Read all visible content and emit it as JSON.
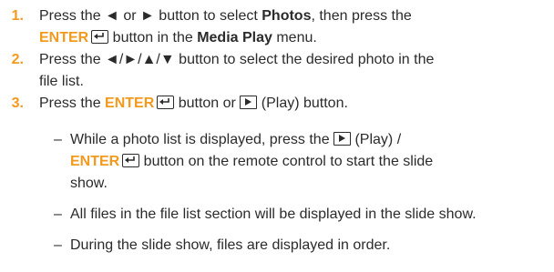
{
  "steps": [
    {
      "number": "1.",
      "line1": {
        "a": "Press the ",
        "left": "◄",
        "b": " or ",
        "right": "►",
        "c": " button to select ",
        "photos": "Photos",
        "d": ", then press the"
      },
      "line2": {
        "enter": "ENTER",
        "a": " button in the ",
        "media_play": "Media Play",
        "b": " menu."
      }
    },
    {
      "number": "2.",
      "line1": {
        "a": "Press the ",
        "arrows": "◄/►/▲/▼",
        "b": " button to select the desired photo in the"
      },
      "line2": "file list."
    },
    {
      "number": "3.",
      "line1": {
        "a": "Press the ",
        "enter": "ENTER",
        "b": " button or ",
        "c": " (Play) button."
      }
    }
  ],
  "notes": [
    {
      "dash": "–",
      "line1": {
        "a": "While a photo list is displayed, press the ",
        "b": " (Play) /"
      },
      "line2": {
        "enter": "ENTER",
        "a": " button on the remote control to start the slide"
      },
      "line3": "show."
    },
    {
      "dash": "–",
      "line1": "All files in the file list section will be displayed in the slide show."
    },
    {
      "dash": "–",
      "line1": "During the slide show, files are displayed in order."
    }
  ],
  "icons": {
    "enter": "enter-key-icon",
    "play": "play-button-icon"
  },
  "colors": {
    "accent": "#f39a1e",
    "text": "#2b2b2b"
  }
}
